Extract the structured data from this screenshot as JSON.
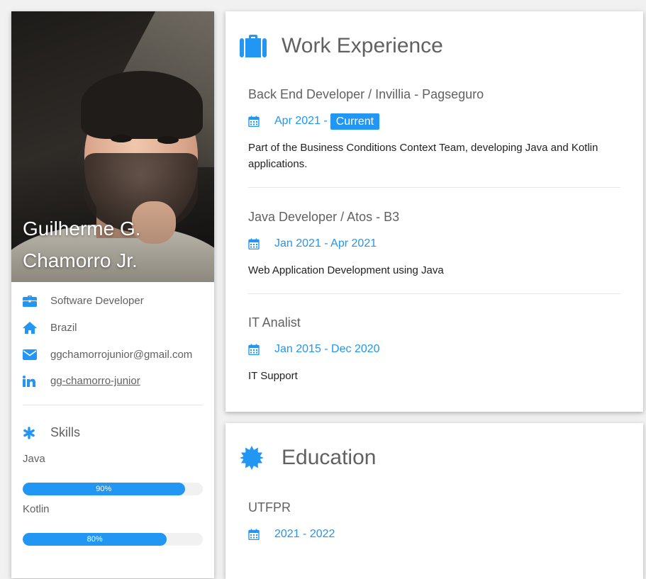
{
  "profile": {
    "name_line1": "Guilherme G.",
    "name_line2": "Chamorro Jr.",
    "info": [
      {
        "icon": "briefcase-icon",
        "text": "Software Developer"
      },
      {
        "icon": "home-icon",
        "text": "Brazil"
      },
      {
        "icon": "envelope-icon",
        "text": "ggchamorrojunior@gmail.com"
      },
      {
        "icon": "linkedin-icon",
        "text": "gg-chamorro-junior"
      }
    ]
  },
  "skills": {
    "title": "Skills",
    "items": [
      {
        "name": "Java",
        "percent_label": "90%",
        "level": 0.9
      },
      {
        "name": "Kotlin",
        "percent_label": "80%",
        "level": 0.8
      }
    ]
  },
  "work": {
    "title": "Work Experience",
    "entries": [
      {
        "title": "Back End Developer / Invillia - Pagseguro",
        "date": "Apr 2021 -",
        "badge": "Current",
        "description": "Part of the Business Conditions Context Team, developing Java and Kotlin applications."
      },
      {
        "title": "Java Developer / Atos - B3",
        "date": "Jan 2021 - Apr 2021",
        "description": "Web Application Development using Java"
      },
      {
        "title": "IT Analist",
        "date": "Jan 2015 - Dec 2020",
        "description": "IT Support"
      }
    ]
  },
  "education": {
    "title": "Education",
    "entries": [
      {
        "title": "UTFPR",
        "date": "2021 - 2022"
      }
    ]
  },
  "colors": {
    "accent": "#2196f3",
    "text_muted": "#616161",
    "background": "#f1f1f1"
  }
}
